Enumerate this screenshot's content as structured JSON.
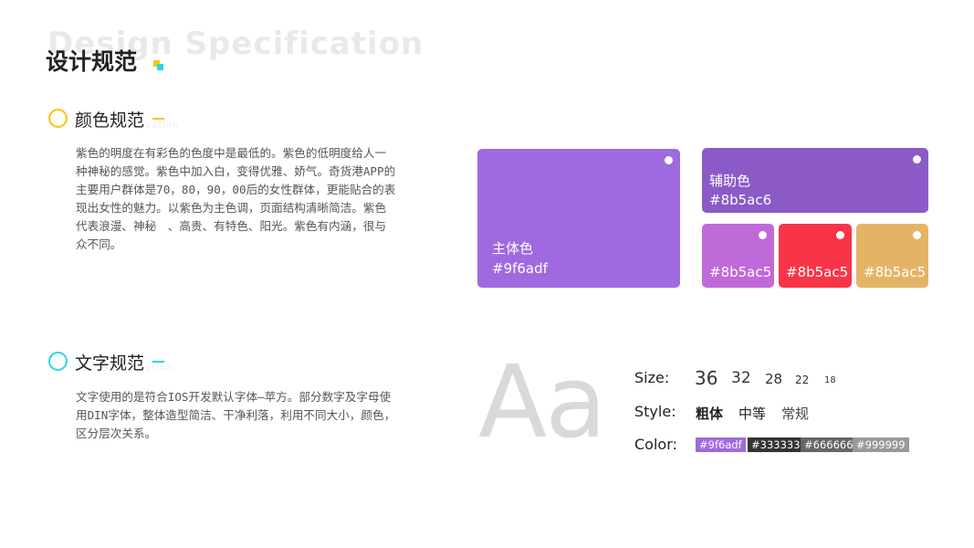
{
  "header": {
    "ghost_title": "Design Specification",
    "title": "设计规范"
  },
  "colors": {
    "purple": "#9f6adf",
    "secondary_purple": "#8b5ac6",
    "pink_purple": "#c069d8",
    "red": "#fa3448",
    "gold": "#e4b466",
    "yellow_accent": "#ffc300",
    "cyan_accent": "#2ad4ea"
  },
  "color_section": {
    "title": "颜色规范",
    "ghost": "Color Specification",
    "paragraph": "紫色的明度在有彩色的色度中是最低的。紫色的低明度给人一种神秘的感觉。紫色中加入白，变得优雅、娇气。奇货港APP的主要用户群体是70，80，90，00后的女性群体，更能贴合的表现出女性的魅力。以紫色为主色调，页面结构清晰简洁。紫色代表浪漫、神秘　、高贵、有特色、阳光。紫色有内涵，很与众不同。",
    "primary": {
      "name": "主体色",
      "hex": "#9f6adf"
    },
    "secondary": {
      "name": "辅助色",
      "hex": "#8b5ac6"
    },
    "small_swatches": [
      {
        "hex": "#8b5ac5"
      },
      {
        "hex": "#8b5ac5"
      },
      {
        "hex": "#8b5ac5"
      }
    ]
  },
  "text_section": {
    "title": "文字规范",
    "ghost": "Text Specification",
    "paragraph": "文字使用的是符合IOS开发默认字体—苹方。部分数字及字母使用DIN字体，整体造型简洁、干净利落，利用不同大小，颜色，区分层次关系。",
    "sample": "Aa",
    "size_label": "Size:",
    "sizes": [
      "36",
      "32",
      "28",
      "22",
      "18"
    ],
    "style_label": "Style:",
    "styles": [
      "粗体",
      "中等",
      "常规"
    ],
    "color_label": "Color:",
    "text_colors": [
      "#9f6adf",
      "#333333",
      "#666666",
      "#999999"
    ]
  }
}
